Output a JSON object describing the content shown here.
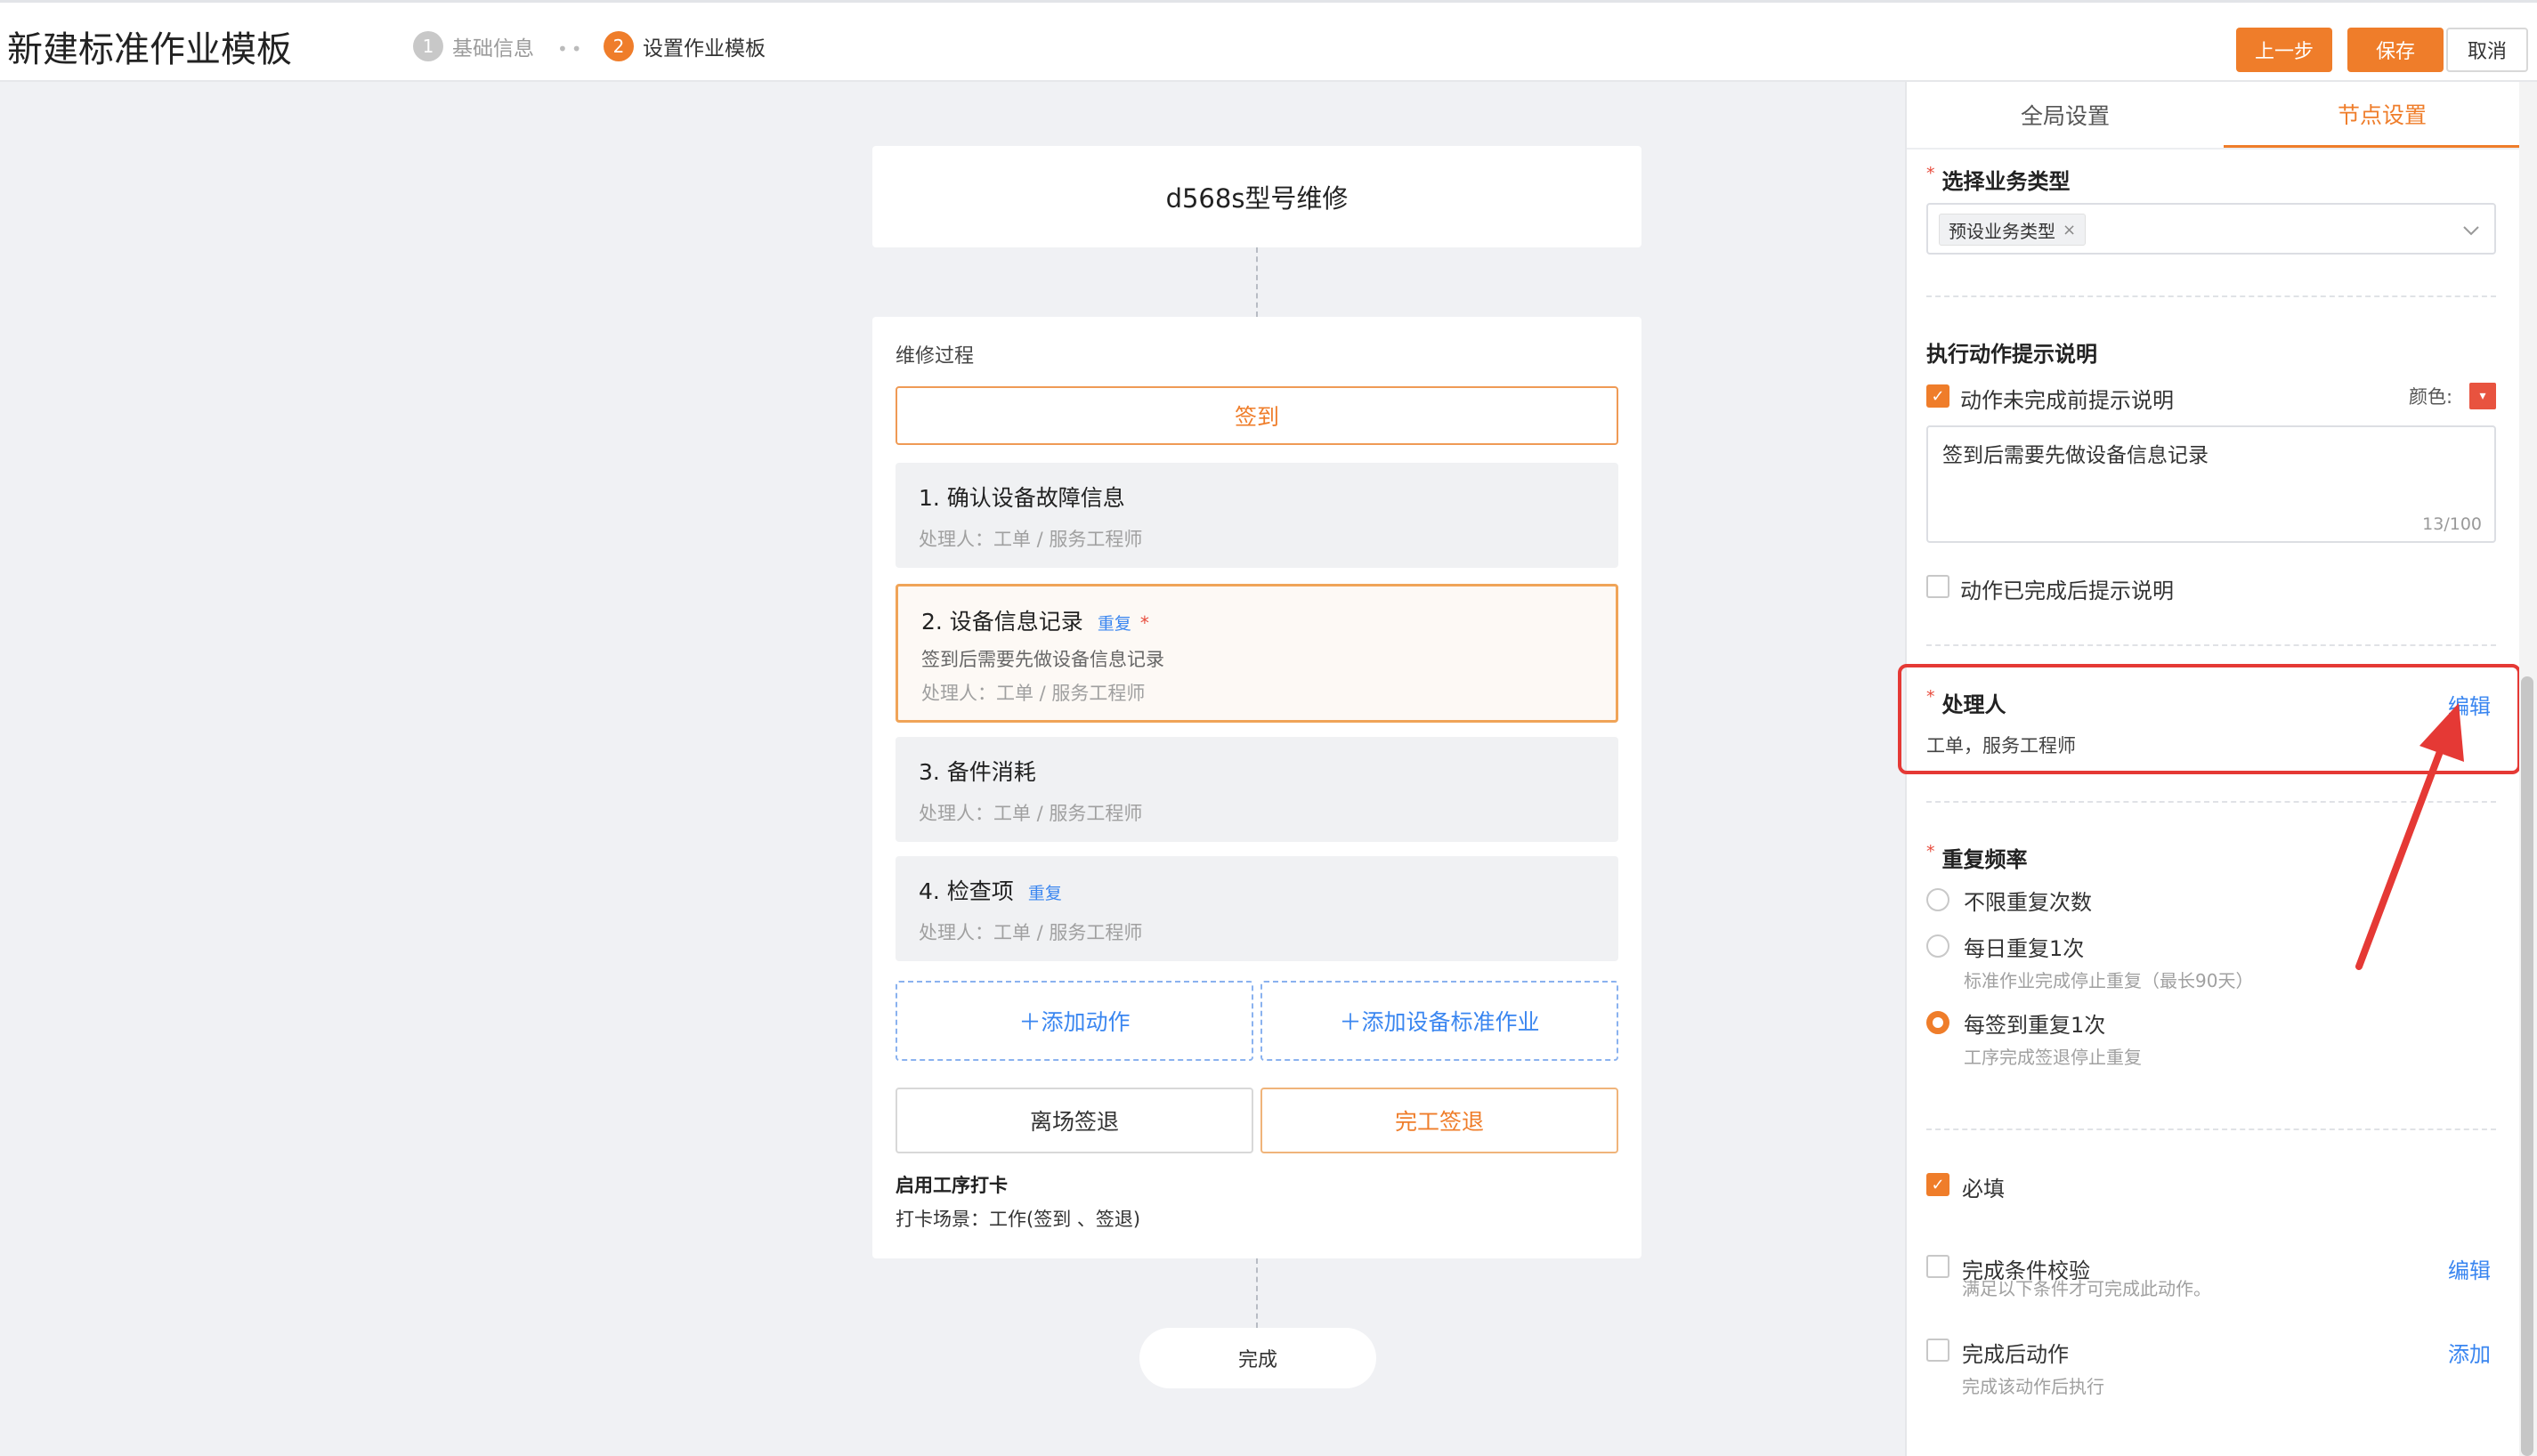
{
  "header": {
    "title": "新建标准作业模板",
    "steps": [
      {
        "num": "1",
        "label": "基础信息"
      },
      {
        "num": "2",
        "label": "设置作业模板"
      }
    ],
    "buttons": {
      "prev": "上一步",
      "save": "保存",
      "cancel": "取消"
    }
  },
  "canvas": {
    "template_name": "d568s型号维修",
    "process_label": "维修过程",
    "signin_label": "签到",
    "actions": [
      {
        "title": "1. 确认设备故障信息",
        "tag": "",
        "desc": "",
        "handler": "处理人：工单 / 服务工程师"
      },
      {
        "title": "2. 设备信息记录",
        "tag": "重复",
        "required": "*",
        "desc": "签到后需要先做设备信息记录",
        "handler": "处理人：工单 / 服务工程师"
      },
      {
        "title": "3. 备件消耗",
        "tag": "",
        "desc": "",
        "handler": "处理人：工单 / 服务工程师"
      },
      {
        "title": "4. 检查项",
        "tag": "重复",
        "desc": "",
        "handler": "处理人：工单 / 服务工程师"
      }
    ],
    "add_action": "＋添加动作",
    "add_standard": "＋添加设备标准作业",
    "leave_signout": "离场签退",
    "finish_signout": "完工签退",
    "punch_title": "启用工序打卡",
    "punch_scene": "打卡场景：工作(签到 、签退)",
    "done_label": "完成"
  },
  "panel": {
    "tabs": [
      "全局设置",
      "节点设置"
    ],
    "active_tab": "节点设置",
    "business_type": {
      "label": "选择业务类型",
      "chip": "预设业务类型"
    },
    "hint": {
      "title": "执行动作提示说明",
      "before_label": "动作未完成前提示说明",
      "before_checked": true,
      "color_label": "颜色:",
      "color_value": "#e8533f",
      "text": "签到后需要先做设备信息记录",
      "counter": "13/100",
      "after_label": "动作已完成后提示说明",
      "after_checked": false
    },
    "handler": {
      "label": "处理人",
      "edit": "编辑",
      "value": "工单，服务工程师"
    },
    "repeat": {
      "label": "重复频率",
      "options": [
        {
          "label": "不限重复次数",
          "sub": "",
          "selected": false
        },
        {
          "label": "每日重复1次",
          "sub": "标准作业完成停止重复（最长90天）",
          "selected": false
        },
        {
          "label": "每签到重复1次",
          "sub": "工序完成签退停止重复",
          "selected": true
        }
      ]
    },
    "required_label": "必填",
    "required_checked": true,
    "check": {
      "label": "完成条件校验",
      "sub": "满足以下条件才可完成此动作。",
      "link": "编辑"
    },
    "after_action": {
      "label": "完成后动作",
      "sub": "完成该动作后执行",
      "link": "添加"
    }
  },
  "colors": {
    "accent": "#ef7d2a",
    "link": "#3a86f0",
    "highlight": "#e53935"
  }
}
